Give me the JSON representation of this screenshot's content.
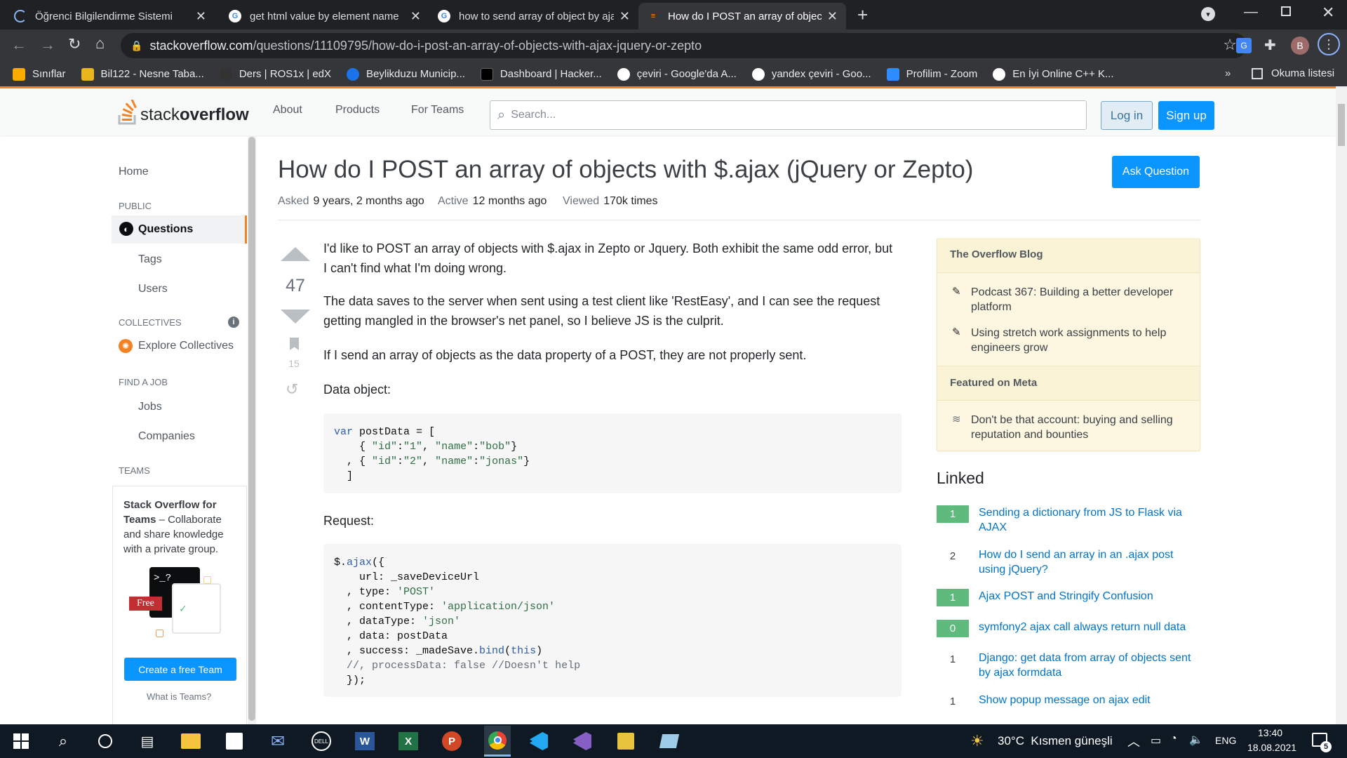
{
  "browser": {
    "tabs": [
      {
        "title": "Öğrenci Bilgilendirme Sistemi",
        "active": false
      },
      {
        "title": "get html value by element name",
        "active": false
      },
      {
        "title": "how to send array of object by ajax",
        "active": false
      },
      {
        "title": "How do I POST an array of objects",
        "active": true
      }
    ],
    "url_host": "stackoverflow.com",
    "url_path": "/questions/11109795/how-do-i-post-an-array-of-objects-with-ajax-jquery-or-zepto",
    "profile_initial": "B",
    "bookmarks": [
      "Sınıflar",
      "Bil122 - Nesne Taba...",
      "Ders | ROS1x | edX",
      "Beylikduzu Municip...",
      "Dashboard | Hacker...",
      "çeviri - Google'da A...",
      "yandex çeviri - Goo...",
      "Profilim - Zoom",
      "En İyi Online C++ K..."
    ],
    "reading_list": "Okuma listesi",
    "more_bookmarks": "»"
  },
  "so_header": {
    "logo_a": "stack",
    "logo_b": "overflow",
    "nav": [
      "About",
      "Products",
      "For Teams"
    ],
    "search_placeholder": "Search...",
    "login": "Log in",
    "signup": "Sign up"
  },
  "left_nav": {
    "home": "Home",
    "public": "PUBLIC",
    "questions": "Questions",
    "tags": "Tags",
    "users": "Users",
    "collectives": "COLLECTIVES",
    "explore": "Explore Collectives",
    "find_job": "FIND A JOB",
    "jobs": "Jobs",
    "companies": "Companies",
    "teams": "TEAMS",
    "teams_title": "Stack Overflow for Teams",
    "teams_desc": " – Collaborate and share knowledge with a private group.",
    "free_badge": "Free",
    "terminal_text": ">_?",
    "create_team": "Create a free Team",
    "what_is": "What is Teams?"
  },
  "question": {
    "title": "How do I POST an array of objects with $.ajax (jQuery or Zepto)",
    "ask_button": "Ask Question",
    "asked_label": "Asked",
    "asked": "9 years, 2 months ago",
    "active_label": "Active",
    "active": "12 months ago",
    "viewed_label": "Viewed",
    "viewed": "170k times",
    "votes": "47",
    "bookmarks": "15",
    "p1": "I'd like to POST an array of objects with $.ajax in Zepto or Jquery. Both exhibit the same odd error, but I can't find what I'm doing wrong.",
    "p2": "The data saves to the server when sent using a test client like 'RestEasy', and I can see the request getting mangled in the browser's net panel, so I believe JS is the culprit.",
    "p3": "If I send an array of objects as the data property of a POST, they are not properly sent.",
    "data_object_label": "Data object:",
    "request_label": "Request:"
  },
  "sidebar": {
    "blog_header": "The Overflow Blog",
    "blog_items": [
      "Podcast 367: Building a better developer platform",
      "Using stretch work assignments to help engineers grow"
    ],
    "meta_header": "Featured on Meta",
    "meta_items": [
      "Don't be that account: buying and selling reputation and bounties"
    ],
    "linked_title": "Linked",
    "linked": [
      {
        "score": "1",
        "title": "Sending a dictionary from JS to Flask via AJAX",
        "accepted": true
      },
      {
        "score": "2",
        "title": "How do I send an array in an .ajax post using jQuery?",
        "accepted": false
      },
      {
        "score": "1",
        "title": "Ajax POST and Stringify Confusion",
        "accepted": true
      },
      {
        "score": "0",
        "title": "symfony2 ajax call always return null data",
        "accepted": true
      },
      {
        "score": "1",
        "title": "Django: get data from array of objects sent by ajax formdata",
        "accepted": false
      },
      {
        "score": "1",
        "title": "Show popup message on ajax edit",
        "accepted": false
      }
    ]
  },
  "taskbar": {
    "weather": "30°C  Kısmen güneşli",
    "lang": "ENG",
    "time": "13:40",
    "date": "18.08.2021",
    "notif": "5"
  }
}
